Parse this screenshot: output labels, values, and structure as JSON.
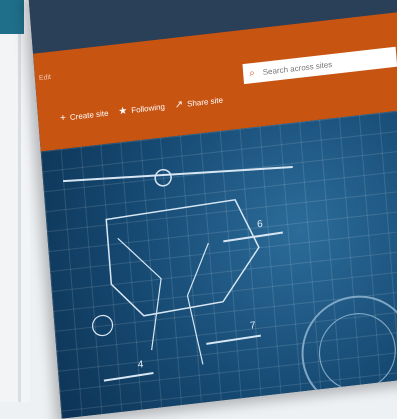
{
  "app": {
    "label": "Edit"
  },
  "topbar": {
    "icons": [
      "bell-icon",
      "gear-icon",
      "help-icon"
    ],
    "help_glyph": "?"
  },
  "actions": [
    {
      "icon": "plus-icon",
      "glyph": "+",
      "label": "Create site"
    },
    {
      "icon": "star-icon",
      "glyph": "★",
      "label": "Following"
    },
    {
      "icon": "share-icon",
      "glyph": "↗",
      "label": "Share site"
    }
  ],
  "search": {
    "placeholder": "Search across sites"
  },
  "hero": {
    "labels": [
      "6",
      "7",
      "4"
    ]
  },
  "colors": {
    "suitebar": "#2a3f58",
    "brand": "#c85412",
    "hero": "#164a73"
  }
}
